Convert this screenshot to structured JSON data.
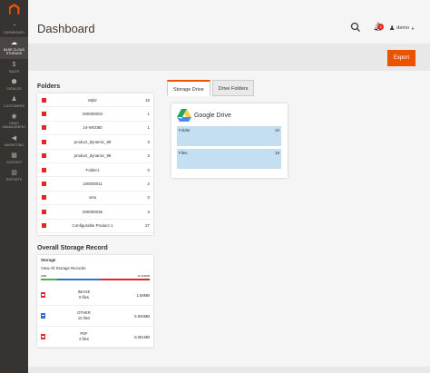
{
  "sidebar": {
    "items": [
      {
        "label": "DASHBOARD",
        "icon": "dashboard-icon"
      },
      {
        "label": "BASE CLOUD STORAGE",
        "icon": "cloud-storage-icon",
        "active": true
      },
      {
        "label": "SALES",
        "icon": "dollar-icon"
      },
      {
        "label": "CATALOG",
        "icon": "cube-icon"
      },
      {
        "label": "CUSTOMERS",
        "icon": "person-icon"
      },
      {
        "label": "DEMO MANAGEMENT",
        "icon": "demo-icon"
      },
      {
        "label": "MARKETING",
        "icon": "megaphone-icon"
      },
      {
        "label": "CONTENT",
        "icon": "content-icon"
      },
      {
        "label": "REPORTS",
        "icon": "bar-chart-icon"
      }
    ]
  },
  "header": {
    "title": "Dashboard",
    "notifications_count": "3",
    "user_name": "demo"
  },
  "toolbar": {
    "export_label": "Export"
  },
  "folders": {
    "title": "Folders",
    "rows": [
      {
        "name": "Mj02",
        "count": "19"
      },
      {
        "name": "000000003",
        "count": "1"
      },
      {
        "name": "24-WG080",
        "count": "1"
      },
      {
        "name": "product_dynamic_99",
        "count": "3"
      },
      {
        "name": "product_dynamic_98",
        "count": "3"
      },
      {
        "name": "Folder1",
        "count": "0"
      },
      {
        "name": "100000011",
        "count": "2"
      },
      {
        "name": "virtu",
        "count": "0"
      },
      {
        "name": "000000035",
        "count": "3"
      },
      {
        "name": "Configurable Product 1",
        "count": "27"
      }
    ]
  },
  "storage": {
    "title": "Overall Storage Record",
    "box_label": "Storage",
    "view_all": "View All Storage Records",
    "bar_min": "0MB",
    "bar_max": "15.496MB",
    "types": [
      {
        "type": "IMAGE",
        "files": "9 files",
        "size": "1.68MB",
        "icon": "image-file-icon"
      },
      {
        "type": "OTHER",
        "files": "15 files",
        "size": "5.925MB",
        "icon": "generic-file-icon"
      },
      {
        "type": "PDF",
        "files": "4 files",
        "size": "8.081MB",
        "icon": "pdf-file-icon"
      }
    ]
  },
  "tabs": [
    {
      "label": "Storage Drive",
      "active": true
    },
    {
      "label": "Drive Folders",
      "active": false
    }
  ],
  "drive": {
    "name": "Google Drive",
    "rows": [
      {
        "label": "Folder",
        "value": "10"
      },
      {
        "label": "Files",
        "value": "18"
      }
    ]
  },
  "colors": {
    "accent": "#eb5202",
    "sidebar_bg": "#373330",
    "image_bar": "#45b45c",
    "other_bar": "#2e73c7",
    "pdf_bar": "#e22626"
  }
}
